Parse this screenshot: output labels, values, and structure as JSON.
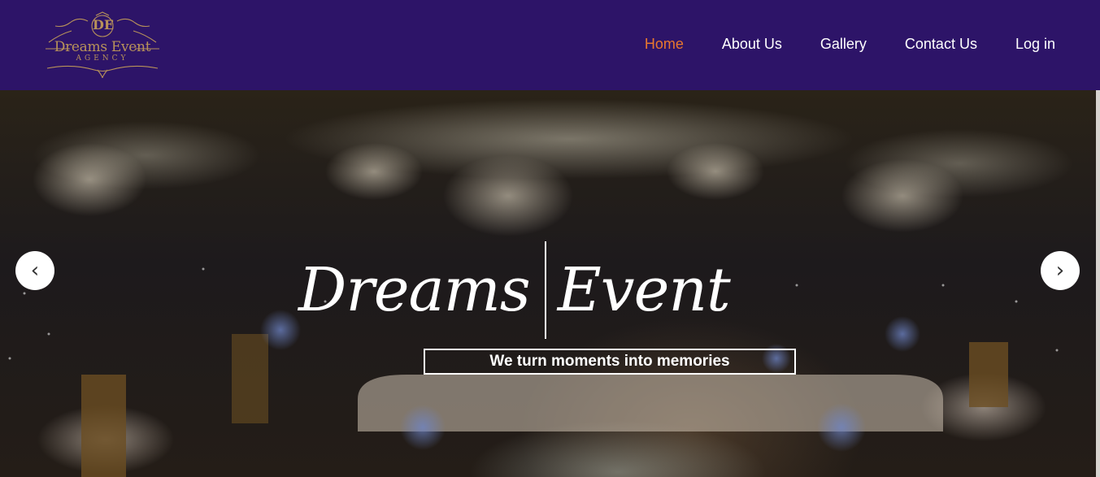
{
  "brand": {
    "monogram": "DE",
    "name": "Dreams Event",
    "subtitle": "AGENCY",
    "color": "#b8925a"
  },
  "nav": {
    "background": "#2d1468",
    "active_color": "#e8772e",
    "items": [
      {
        "label": "Home",
        "active": true
      },
      {
        "label": "About Us",
        "active": false
      },
      {
        "label": "Gallery",
        "active": false
      },
      {
        "label": "Contact Us",
        "active": false
      },
      {
        "label": "Log in",
        "active": false
      }
    ]
  },
  "hero": {
    "title_part1": "Dreams",
    "title_part2": "Event",
    "tagline": "We turn moments into memories",
    "prev_icon": "‹",
    "next_icon": "›"
  }
}
